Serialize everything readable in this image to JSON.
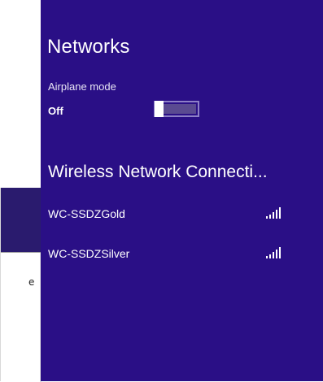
{
  "background_window": {
    "dialog_text": "e"
  },
  "networks_panel": {
    "title": "Networks",
    "airplane_mode": {
      "label": "Airplane mode",
      "state": "Off"
    },
    "connection_heading": "Wireless Network Connecti...",
    "networks": [
      {
        "name": "WC-SSDZGold",
        "signal_icon": "wifi-signal-full-icon",
        "signal_bars": 5
      },
      {
        "name": "WC-SSDZSilver",
        "signal_icon": "wifi-signal-full-icon",
        "signal_bars": 5
      }
    ]
  },
  "colors": {
    "panel_background": "#2a0f86",
    "text": "#ffffff",
    "toggle_track": "#5a4a91",
    "background_titlebar": "#2a1b6e"
  }
}
